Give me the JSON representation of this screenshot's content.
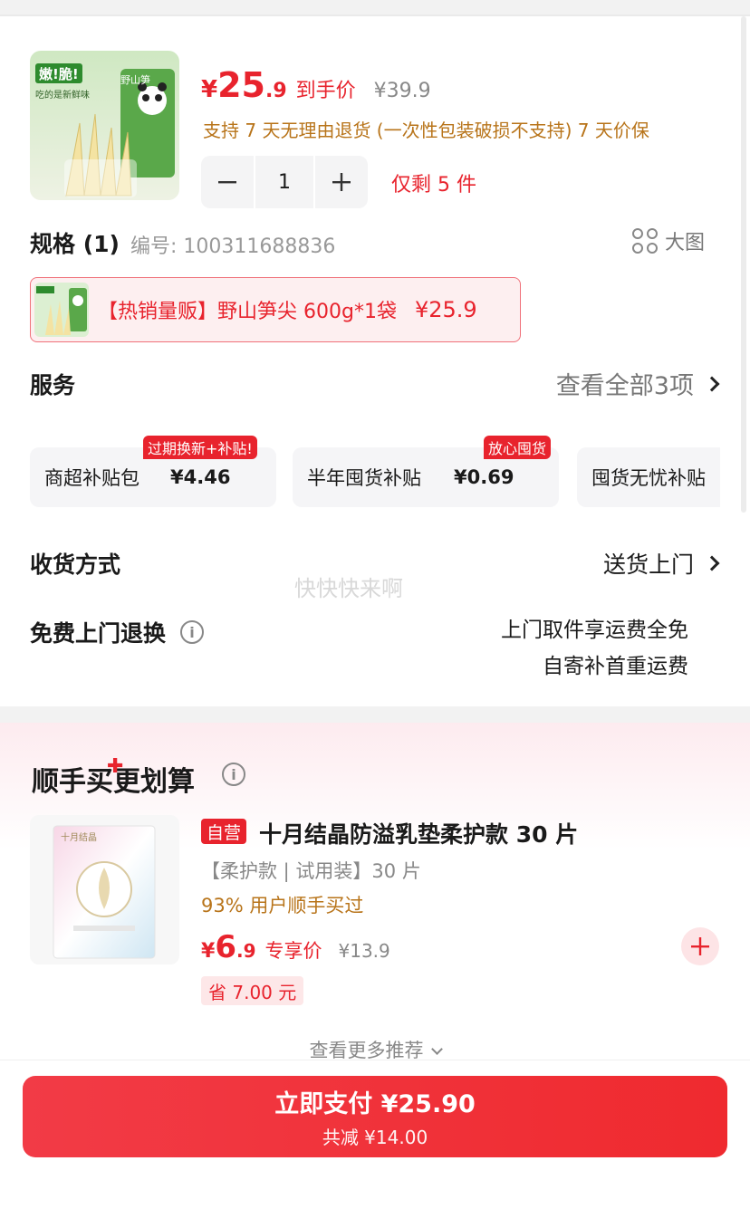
{
  "product": {
    "price_currency": "¥",
    "price_int": "25",
    "price_dec": ".9",
    "price_tag": "到手价",
    "original_price": "¥39.9",
    "policy": "支持 7 天无理由退货 (一次性包装破损不支持)  7 天价保",
    "quantity": "1",
    "stock": "仅剩 5 件",
    "thumb_text_1": "嫩!脆!",
    "thumb_text_2": "吃的是新鲜味",
    "thumb_text_3": "野山笋"
  },
  "spec": {
    "title": "规格 (1)",
    "code": "编号: 100311688836",
    "bigpic_label": "大图",
    "sku_label": "【热销量贩】野山笋尖 600g*1袋",
    "sku_price": "¥25.9"
  },
  "service": {
    "title": "服务",
    "view_all": "查看全部3项",
    "cards": [
      {
        "name": "商超补贴包",
        "amount": "¥4.46",
        "badge": "过期换新+补贴!"
      },
      {
        "name": "半年囤货补贴",
        "amount": "¥0.69",
        "badge": "放心囤货"
      },
      {
        "name": "囤货无忧补贴",
        "amount": "",
        "badge": ""
      }
    ]
  },
  "delivery": {
    "title": "收货方式",
    "value": "送货上门"
  },
  "watermark": "快快快来啊",
  "returns": {
    "title": "免费上门退换",
    "note_1": "上门取件享运费全免",
    "note_2": "自寄补首重运费"
  },
  "recommend": {
    "title": "顺手买更划算",
    "badge": "自营",
    "name": "十月结晶防溢乳垫柔护款 30 片",
    "spec": "【柔护款 | 试用装】30 片",
    "bought": "93% 用户顺手买过",
    "price_currency": "¥",
    "price_int": "6",
    "price_dec": ".9",
    "price_tag": "专享价",
    "original_price": "¥13.9",
    "saved": "省 7.00 元",
    "more": "查看更多推荐",
    "thumb_brand": "十月结晶"
  },
  "pay": {
    "label": "立即支付 ¥25.90",
    "sub": "共减 ¥14.00"
  },
  "colors": {
    "accent": "#e8232d",
    "gold": "#b8741a",
    "gray_text": "#888888"
  }
}
